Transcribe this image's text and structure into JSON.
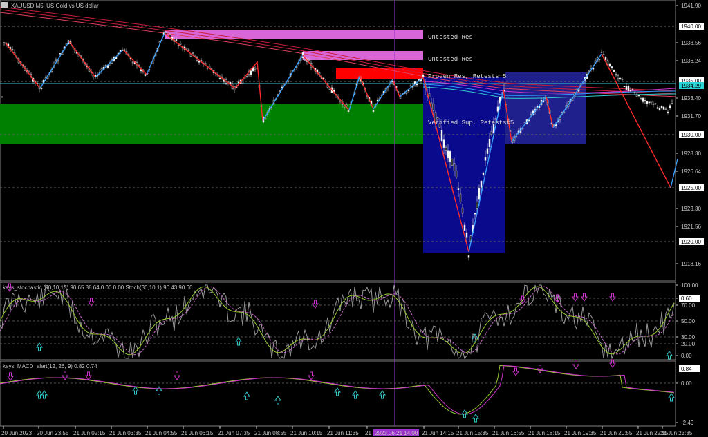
{
  "window": {
    "title": "XAUUSD,M5: US Gold vs US dollar"
  },
  "colors": {
    "bull": "#e8e8e8",
    "bear": "#ffffff",
    "zigzag_down": "#ff2a2a",
    "zigzag_up": "#3aa0ff",
    "support": "#008000",
    "resistance_red": "#ff0000",
    "resistance_pink": "#d966d6",
    "blue_zone": "#1c1c9e",
    "panel_sep": "#808080"
  },
  "price_axis": {
    "ticks": [
      "1941.90",
      "1938.56",
      "1936.24",
      "1933.40",
      "1931.70",
      "1928.30",
      "1926.64",
      "1923.30",
      "1921.56",
      "1918.16"
    ],
    "boxed": [
      "1940.00",
      "1935.00",
      "1934.29",
      "1930.00",
      "1925.00",
      "1920.00"
    ]
  },
  "zones": [
    {
      "label": "Untested Res"
    },
    {
      "label": "Untested Res"
    },
    {
      "label": "Proven Res, Retests=5"
    },
    {
      "label": "Verified Sup, Retests=5"
    }
  ],
  "stoch": {
    "title": "keys_stochastic (30,10,10) 90.65 88.64 0.00 0.00 Stoch(30,10,1) 90.43 90.60",
    "axis": [
      "100.00",
      "80.00",
      "70.00",
      "50.00",
      "30.00",
      "20.00",
      "0.00"
    ],
    "boxed": "0.60"
  },
  "macd": {
    "title": "keys_MACD_alert(12, 26, 9) 0.82 0.74",
    "axis": [
      "0.00",
      "-2.49"
    ],
    "boxed": "0.84"
  },
  "time_axis": {
    "labels": [
      "20 Jun 2023",
      "20 Jun 23:55",
      "21 Jun 02:15",
      "21 Jun 03:35",
      "21 Jun 04:55",
      "21 Jun 06:15",
      "21 Jun 07:35",
      "21 Jun 08:55",
      "21 Jun 10:15",
      "21 Jun 11:35",
      "21",
      "21 Jun 14:15",
      "21 Jun 15:35",
      "21 Jun 16:55",
      "21 Jun 18:15",
      "21 Jun 19:35",
      "21 Jun 20:55",
      "21 Jun 22:15",
      "21 Jun 23:35"
    ],
    "cursor_label": "2023.06.21 14:00"
  }
}
